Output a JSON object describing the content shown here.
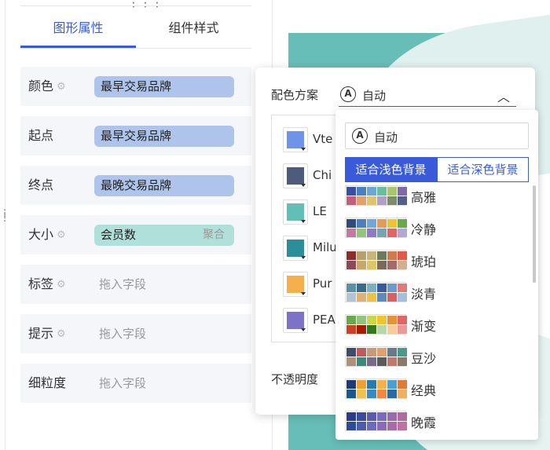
{
  "tabs": [
    {
      "label": "图形属性",
      "active": true
    },
    {
      "label": "组件样式",
      "active": false
    }
  ],
  "fields": [
    {
      "label": "颜色",
      "gear": true,
      "chip": "最早交易品牌",
      "chip_color": "#afc4ea"
    },
    {
      "label": "起点",
      "gear": false,
      "chip": "最早交易品牌",
      "chip_color": "#afc4ea"
    },
    {
      "label": "终点",
      "gear": false,
      "chip": "最晚交易品牌",
      "chip_color": "#afc4ea"
    },
    {
      "label": "大小",
      "gear": true,
      "chip": "会员数",
      "chip_color": "#b0e0da",
      "agg": "聚合"
    },
    {
      "label": "标签",
      "gear": true,
      "placeholder": "拖入字段"
    },
    {
      "label": "提示",
      "gear": true,
      "placeholder": "拖入字段"
    },
    {
      "label": "细粒度",
      "gear": false,
      "placeholder": "拖入字段"
    }
  ],
  "popup": {
    "scheme_label": "配色方案",
    "scheme_value": "自动",
    "auto_glyph": "A",
    "opacity_label": "不透明度",
    "swatches": [
      {
        "name": "Vte",
        "color": "#6f93e8"
      },
      {
        "name": "Chi",
        "color": "#4d5c7c"
      },
      {
        "name": "LE",
        "color": "#62bfb6"
      },
      {
        "name": "Milu",
        "color": "#2b8f9a"
      },
      {
        "name": "Pur",
        "color": "#f5b04d"
      },
      {
        "name": "PEA",
        "color": "#7c72c8"
      }
    ]
  },
  "dropdown": {
    "auto_label": "自动",
    "light_bg": "适合浅色背景",
    "dark_bg": "适合深色背景",
    "palettes": [
      {
        "name": "高雅",
        "colors": [
          "#3d4ca4",
          "#4a7fc1",
          "#6aa7d8",
          "#6abf9a",
          "#a7c76a",
          "#7e6aa8",
          "#c0607a",
          "#e2a06b",
          "#e0c46d",
          "#b0a0c8",
          "#7d8c6a",
          "#555e8a"
        ]
      },
      {
        "name": "冷静",
        "colors": [
          "#2f4b7c",
          "#4a7fc1",
          "#6fa8dc",
          "#e69b5a",
          "#f1c232",
          "#6aa84f",
          "#c27ba0",
          "#93c47d",
          "#8e7cc3",
          "#76a5af",
          "#e06666",
          "#b4a7d6"
        ]
      },
      {
        "name": "琥珀",
        "colors": [
          "#8c2d2d",
          "#b7a06a",
          "#c9b47a",
          "#6a7a5a",
          "#d47a4a",
          "#e05a4a",
          "#8a4a5a",
          "#c8a86a",
          "#e0c46a",
          "#7a6a5a",
          "#a46a6a",
          "#d0b090"
        ]
      },
      {
        "name": "淡青",
        "colors": [
          "#5c8fa8",
          "#3a6a8a",
          "#7ab0c0",
          "#3a5a9a",
          "#6a9ad0",
          "#e07a7a",
          "#b0c4d8",
          "#e0b070",
          "#f0c040",
          "#5a8ac0",
          "#d86060",
          "#a0c0e0"
        ]
      },
      {
        "name": "渐变",
        "colors": [
          "#6aa84f",
          "#93c47d",
          "#c9d84a",
          "#f1c232",
          "#e69138",
          "#e06666",
          "#cc4125",
          "#a61c00",
          "#38761d",
          "#b6d7a8",
          "#f9cb9c",
          "#ea9999"
        ]
      },
      {
        "name": "豆沙",
        "colors": [
          "#3d4c6a",
          "#c05a5a",
          "#c89a7a",
          "#e0a070",
          "#6a7a8a",
          "#4a9a8a",
          "#b0907a",
          "#3a8a7a",
          "#7a6a8a",
          "#5a5a5a",
          "#c07a6a",
          "#8a7a6a"
        ]
      },
      {
        "name": "经典",
        "colors": [
          "#1f3b73",
          "#f0a030",
          "#2a7ab0",
          "#f5b24a",
          "#4aa0d0",
          "#e07a3a",
          "#1a5a8a",
          "#f0c050",
          "#3a8ac0",
          "#f08a40",
          "#2a6aa0",
          "#f0b060"
        ]
      },
      {
        "name": "晚霞",
        "colors": [
          "#2b3a8a",
          "#3a4aa0",
          "#5a5ab0",
          "#7a6ac0",
          "#9a6ab0",
          "#b06aa0",
          "#2a4a9a",
          "#4a5ab0",
          "#6a6ac0",
          "#8a6ab8",
          "#a86aa8",
          "#c070a0"
        ]
      }
    ]
  }
}
